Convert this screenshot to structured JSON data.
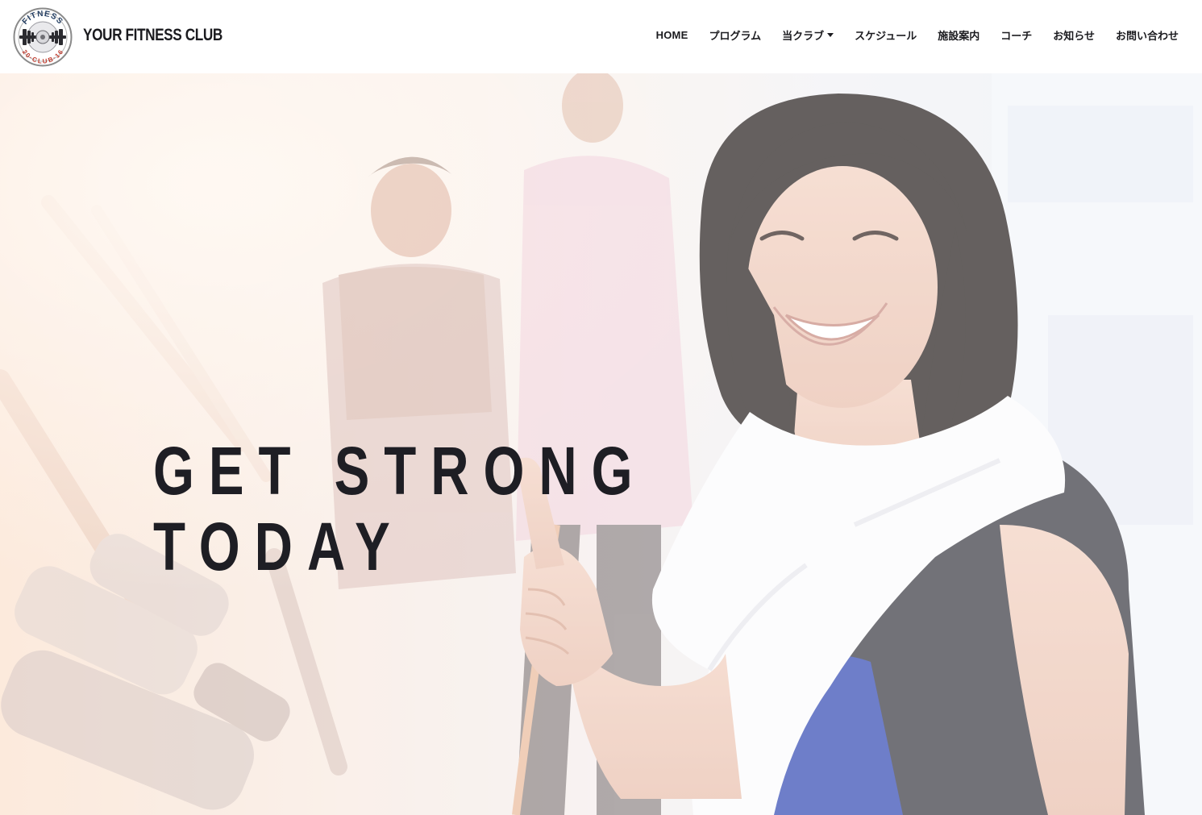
{
  "header": {
    "logo": {
      "icon": "barbell-badge-icon",
      "text_top": "FITNESS",
      "text_bottom": "20·CLUB·16"
    },
    "brand_name": "YOUR FITNESS CLUB",
    "nav": [
      {
        "label": "HOME",
        "has_dropdown": false
      },
      {
        "label": "プログラム",
        "has_dropdown": false
      },
      {
        "label": "当クラブ",
        "has_dropdown": true
      },
      {
        "label": "スケジュール",
        "has_dropdown": false
      },
      {
        "label": "施設案内",
        "has_dropdown": false
      },
      {
        "label": "コーチ",
        "has_dropdown": false
      },
      {
        "label": "お知らせ",
        "has_dropdown": false
      },
      {
        "label": "お問い合わせ",
        "has_dropdown": false
      }
    ]
  },
  "hero": {
    "title_line1": "GET STRONG",
    "title_line2": "TODAY",
    "image": "smiling-woman-gym-thumbs-up"
  },
  "colors": {
    "text_dark": "#1e1e24",
    "logo_red": "#c0392b",
    "logo_navy": "#1f3a5f",
    "header_bg": "#ffffff"
  }
}
